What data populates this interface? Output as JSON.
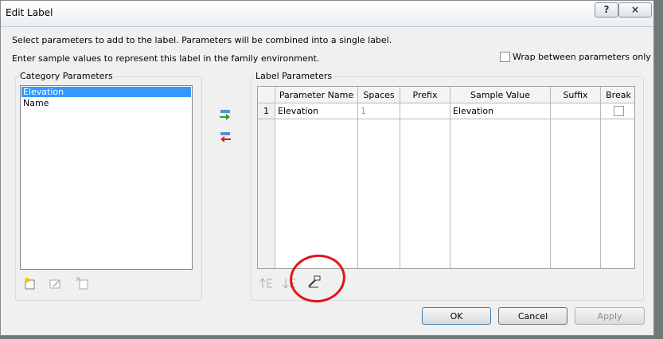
{
  "window": {
    "title": "Edit Label",
    "help_glyph": "?",
    "close_glyph": "×"
  },
  "info": {
    "line1": "Select parameters to add to the label.  Parameters will be combined into a single label.",
    "line2": "Enter sample values to represent this label in the family environment."
  },
  "wrap_option": {
    "label": "Wrap between parameters only",
    "checked": false
  },
  "category_parameters": {
    "title": "Category Parameters",
    "items": [
      {
        "label": "Elevation",
        "selected": true
      },
      {
        "label": "Name",
        "selected": false
      }
    ]
  },
  "label_parameters": {
    "title": "Label Parameters",
    "columns": [
      "Parameter Name",
      "Spaces",
      "Prefix",
      "Sample Value",
      "Suffix",
      "Break"
    ],
    "rows": [
      {
        "index": "1",
        "parameter_name": "Elevation",
        "spaces": "1",
        "prefix": "",
        "sample_value": "Elevation",
        "suffix": "",
        "break": false
      }
    ]
  },
  "icons": {
    "add_parameter": "add-to-label-icon",
    "remove_parameter": "remove-from-label-icon",
    "new_parameter": "new-parameter-icon",
    "edit_parameter": "edit-parameter-icon",
    "delete_parameter": "delete-parameter-icon",
    "move_up": "move-up-icon",
    "move_down": "move-down-icon",
    "edit_units": "edit-units-icon"
  },
  "buttons": {
    "ok": "OK",
    "cancel": "Cancel",
    "apply": "Apply"
  },
  "colors": {
    "selection": "#3399ff",
    "annotation": "#e0161a"
  }
}
